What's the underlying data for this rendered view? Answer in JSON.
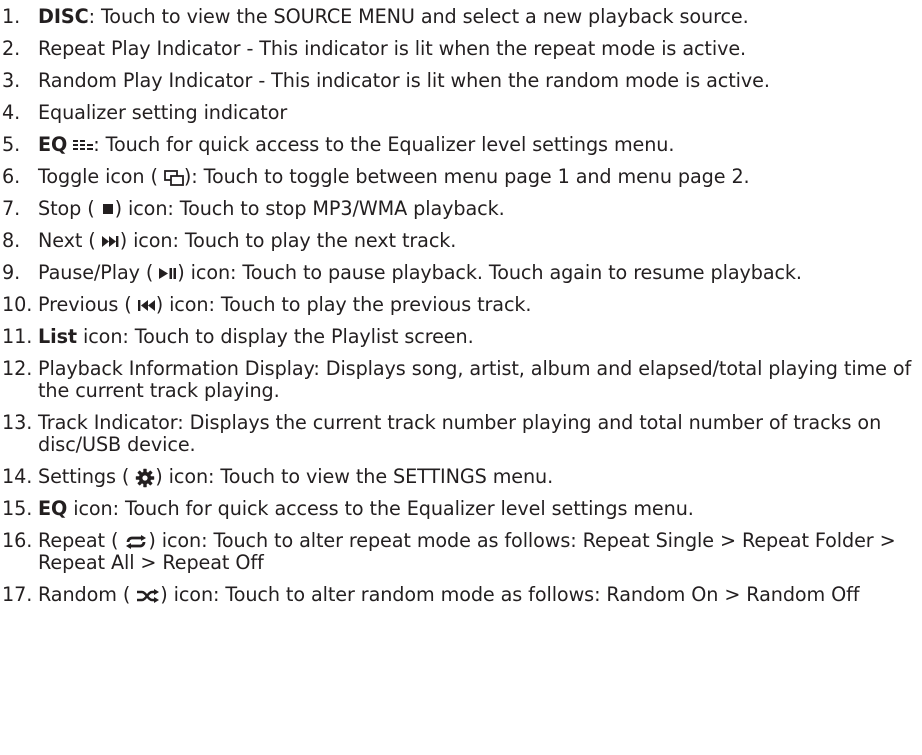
{
  "items": [
    {
      "num": "1.",
      "bold": "DISC",
      "text": ": Touch to view the SOURCE MENU and select a new playback source."
    },
    {
      "num": "2.",
      "text": "Repeat Play Indicator - This indicator is lit when the repeat mode is active."
    },
    {
      "num": "3.",
      "text": "Random Play Indicator - This indicator is lit when the random mode is active."
    },
    {
      "num": "4.",
      "text": "Equalizer setting indicator"
    },
    {
      "num": "5.",
      "bold": "EQ",
      "text": ": Touch for quick access to the Equalizer level settings menu."
    },
    {
      "num": "6.",
      "pre": "Toggle icon (",
      "post": "): Touch to toggle between menu page 1 and menu page 2."
    },
    {
      "num": "7.",
      "pre": "Stop (",
      "post": ") icon: Touch to stop MP3/WMA playback."
    },
    {
      "num": "8.",
      "pre": "Next (",
      "post": ") icon: Touch to play the next track."
    },
    {
      "num": "9.",
      "pre": "Pause/Play (",
      "post": ") icon: Touch to pause playback. Touch again to resume playback."
    },
    {
      "num": "10.",
      "pre": "Previous (",
      "post": ") icon: Touch to play the previous track."
    },
    {
      "num": "11.",
      "bold": "List",
      "text": " icon: Touch to display the Playlist screen."
    },
    {
      "num": "12.",
      "text": "Playback Information Display: Displays song, artist, album and elapsed/total playing time of the current track playing."
    },
    {
      "num": "13.",
      "text": "Track Indicator: Displays the current track number playing and total number of tracks on disc/USB device."
    },
    {
      "num": "14.",
      "pre": "Settings (",
      "post": ") icon: Touch to view the SETTINGS menu."
    },
    {
      "num": "15.",
      "bold": "EQ",
      "text": " icon: Touch for quick access to the Equalizer level settings menu."
    },
    {
      "num": "16.",
      "pre": "Repeat (",
      "post": ") icon: Touch to alter repeat mode as follows: Repeat Single > Repeat Folder > Repeat All > Repeat Off"
    },
    {
      "num": "17.",
      "pre": "Random (",
      "post": ") icon: Touch to alter random mode as follows: Random On > Random Off"
    }
  ],
  "icons": {
    "eq": "equalizer-icon",
    "toggle": "toggle-page-icon",
    "stop": "stop-icon",
    "next": "next-track-icon",
    "pause_play": "pause-play-icon",
    "previous": "previous-track-icon",
    "settings": "settings-gear-icon",
    "repeat": "repeat-icon",
    "random": "random-icon"
  },
  "colors": {
    "text": "#231f20"
  }
}
